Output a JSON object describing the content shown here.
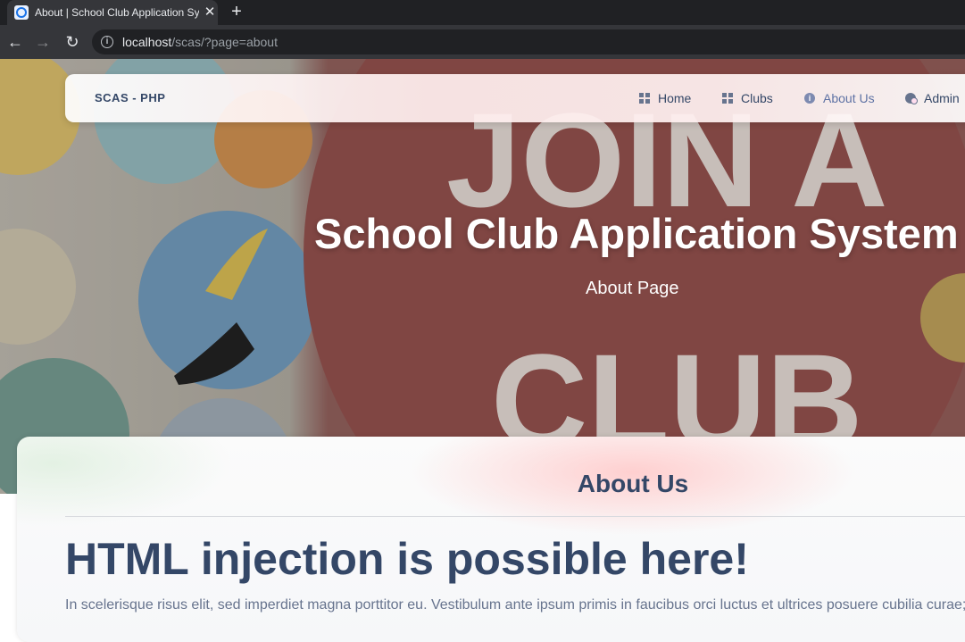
{
  "browser": {
    "tab_title": "About | School Club Application System",
    "tab_close": "✕",
    "new_tab": "+",
    "url_host": "localhost",
    "url_path": "/scas/?page=about",
    "back": "←",
    "forward": "→",
    "reload": "↻",
    "info": "i"
  },
  "navbar": {
    "brand": "SCAS - PHP",
    "items": [
      {
        "label": "Home",
        "icon": "dashboard-icon"
      },
      {
        "label": "Clubs",
        "icon": "grid-icon"
      },
      {
        "label": "About Us",
        "icon": "info-icon",
        "active": true
      },
      {
        "label": "Admin",
        "icon": "admin-icon"
      }
    ]
  },
  "hero": {
    "title": "School Club Application System",
    "subtitle": "About Page"
  },
  "content": {
    "section_title": "About Us",
    "heading": "HTML injection is possible here!",
    "paragraph": "In scelerisque risus elit, sed imperdiet magna porttitor eu. Vestibulum ante ipsum primis in faucibus orci luctus et ultrices posuere cubilia curae; Aliquam erat volutpat."
  },
  "colors": {
    "accent": "#344767",
    "active_nav": "#5e72a4",
    "body_text": "#67748e"
  }
}
